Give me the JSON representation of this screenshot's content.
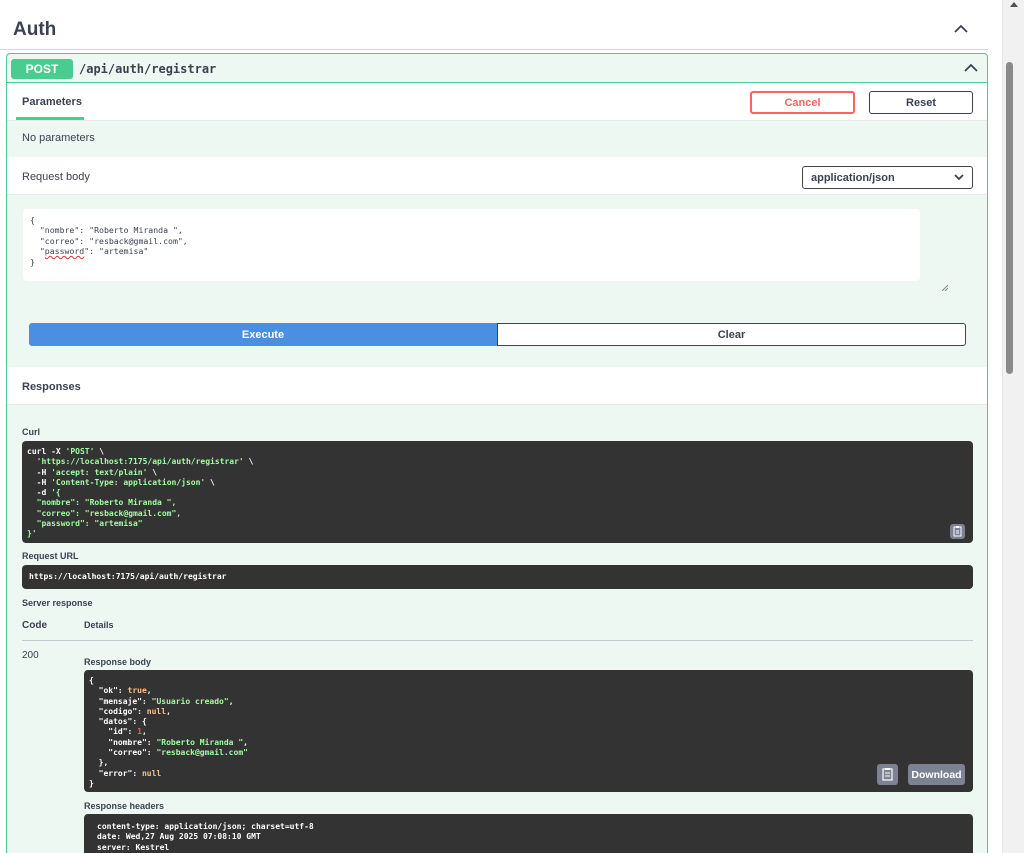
{
  "section": {
    "title": "Auth"
  },
  "operation": {
    "method": "POST",
    "path": "/api/auth/registrar"
  },
  "parameters": {
    "tab_label": "Parameters",
    "cancel_label": "Cancel",
    "reset_label": "Reset",
    "empty_text": "No parameters"
  },
  "request_body": {
    "label": "Request body",
    "content_type": "application/json",
    "json_lines": [
      "{",
      "  \"nombre\": \"Roberto Miranda \",",
      "  \"correo\": \"resback@gmail.com\",",
      "  \"",
      "password",
      "\": \"artemisa\"",
      "}"
    ]
  },
  "actions": {
    "execute_label": "Execute",
    "clear_label": "Clear"
  },
  "responses": {
    "title": "Responses",
    "curl_label": "Curl",
    "request_url_label": "Request URL",
    "request_url": "https://localhost:7175/api/auth/registrar",
    "server_response_label": "Server response",
    "code_header": "Code",
    "details_header": "Details",
    "status_code": "200",
    "response_body_label": "Response body",
    "download_label": "Download",
    "response_headers_label": "Response headers",
    "headers_lines": [
      "content-type: application/json; charset=utf-8",
      "date: Wed,27 Aug 2025 07:08:10 GMT",
      "server: Kestrel"
    ]
  },
  "curl": {
    "l1a": "curl -X ",
    "l1b": "'POST'",
    "l1c": " \\",
    "l2a": "  ",
    "l2b": "'https://localhost:7175/api/auth/registrar'",
    "l2c": " \\",
    "l3a": "  -H ",
    "l3b": "'accept: text/plain'",
    "l3c": " \\",
    "l4a": "  -H ",
    "l4b": "'Content-Type: application/json'",
    "l4c": " \\",
    "l5a": "  -d ",
    "l5b": "'{",
    "l6": "  \"nombre\": \"Roberto Miranda \",",
    "l7": "  \"correo\": \"resback@gmail.com\",",
    "l8": "  \"password\": \"artemisa\"",
    "l9": "}'"
  },
  "response_body": {
    "open": "{",
    "ok_key": "  \"ok\": ",
    "ok_val": "true",
    "comma": ",",
    "mensaje_key": "  \"mensaje\": ",
    "mensaje_val": "\"Usuario creado\"",
    "codigo_key": "  \"codigo\": ",
    "codigo_val": "null",
    "datos_key": "  \"datos\": {",
    "id_key": "    \"id\": ",
    "id_val": "1",
    "nombre_key": "    \"nombre\": ",
    "nombre_val": "\"Roberto Miranda \"",
    "correo_key": "    \"correo\": ",
    "correo_val": "\"resback@gmail.com\"",
    "datos_close": "  },",
    "error_key": "  \"error\": ",
    "error_val": "null",
    "close": "}"
  },
  "icons": {
    "collapse": "chevron-up-icon",
    "dropdown": "chevron-down-icon",
    "copy": "clipboard-icon"
  },
  "colors": {
    "post": "#49cc90",
    "execute": "#4990e2",
    "cancel": "#ff6060",
    "code_bg": "#333333"
  }
}
